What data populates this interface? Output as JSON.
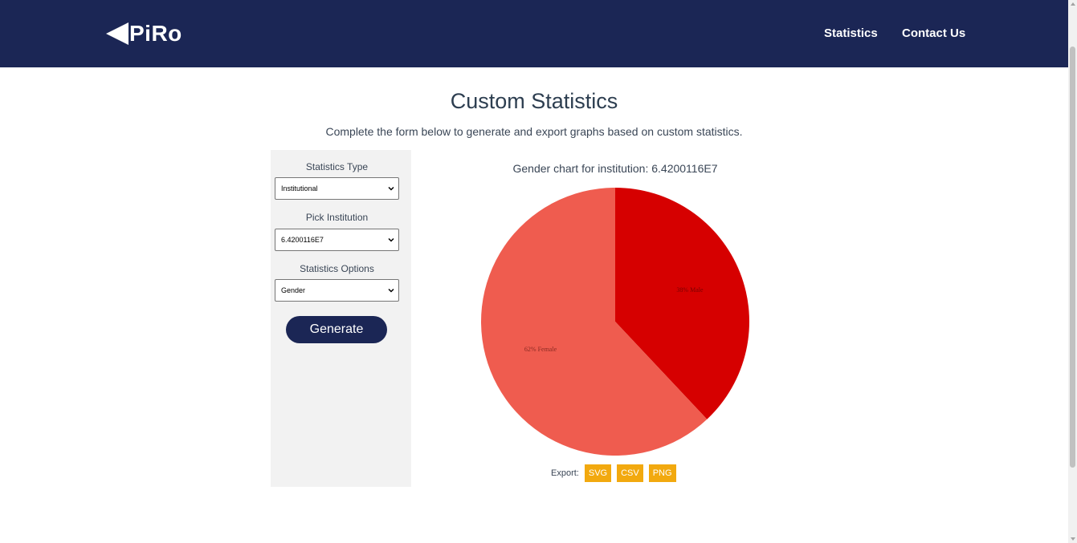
{
  "nav": {
    "logo_text": "PiRo",
    "links": [
      "Statistics",
      "Contact Us"
    ]
  },
  "page": {
    "title": "Custom Statistics",
    "subtitle": "Complete the form below to generate and export graphs based on custom statistics."
  },
  "form": {
    "statistics_type": {
      "label": "Statistics Type",
      "value": "Institutional"
    },
    "pick_institution": {
      "label": "Pick Institution",
      "value": "6.4200116E7"
    },
    "statistics_options": {
      "label": "Statistics Options",
      "value": "Gender"
    },
    "generate_label": "Generate"
  },
  "chart_data": {
    "type": "pie",
    "title": "Gender chart for institution: 6.4200116E7",
    "slices": [
      {
        "label": "38% Male",
        "value": 38,
        "color": "#d60000"
      },
      {
        "label": "62% Female",
        "value": 62,
        "color": "#ef5c4f"
      }
    ]
  },
  "export": {
    "label": "Export:",
    "buttons": [
      "SVG",
      "CSV",
      "PNG"
    ]
  },
  "colors": {
    "navbar": "#1b2655",
    "export_button": "#f2a90f",
    "panel": "#f2f2f2"
  }
}
